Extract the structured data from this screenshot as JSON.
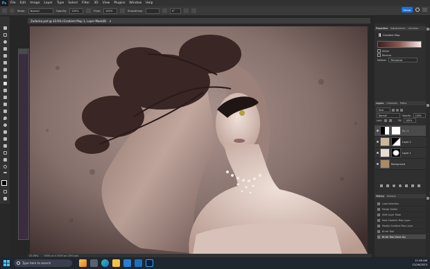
{
  "menubar": {
    "logo": "Ps",
    "items": [
      "File",
      "Edit",
      "Image",
      "Layer",
      "Type",
      "Select",
      "Filter",
      "3D",
      "View",
      "Plugins",
      "Window",
      "Help"
    ]
  },
  "options": {
    "mode_label": "Mode:",
    "mode_value": "Normal",
    "opacity_label": "Opacity:",
    "opacity_value": "100%",
    "flow_label": "Flow:",
    "flow_value": "100%",
    "smoothing_label": "Smoothing:",
    "smoothing_value": "",
    "angle_value": "0°",
    "share_label": "Share"
  },
  "document": {
    "tab_title": "Zadecka.psd @ 43.6% (Gradient Map 1, Layer Mask/8)",
    "close": "×",
    "status_zoom": "43.06%",
    "status_info": "3000 px x 2000 px (300 ppi)"
  },
  "properties": {
    "tabs": [
      "Properties",
      "Adjustments",
      "Libraries"
    ],
    "title": "Gradient Map",
    "dither_label": "Dither",
    "reverse_label": "Reverse",
    "method_label": "Method:",
    "method_value": "Perceptual"
  },
  "layers": {
    "tabs": [
      "Layers",
      "Channels",
      "Paths"
    ],
    "kind_label": "Kind",
    "blend_value": "Normal",
    "opacity_label": "Opacity:",
    "opacity_value": "100%",
    "lock_label": "Lock:",
    "fill_label": "Fill:",
    "fill_value": "100%",
    "rows": [
      {
        "name": "Gr...1"
      },
      {
        "name": "Layer 2"
      },
      {
        "name": "Layer 1"
      },
      {
        "name": "Background"
      }
    ]
  },
  "history": {
    "tabs": [
      "History",
      "Actions"
    ],
    "items": [
      "Load Selection",
      "Merge Visible",
      "Shift Layer Mask",
      "New Gradient Map Layer",
      "Modify Gradient Map Layer",
      "Brush Tool",
      "Brush Tool (Save As)"
    ]
  },
  "taskbar": {
    "search_placeholder": "Type here to search",
    "time": "11:58 AM",
    "date": "12/26/2023"
  },
  "colors": {
    "accent": "#1473e6",
    "canvas_tone": "#6c5652",
    "ps_blue": "#31a8ff"
  }
}
